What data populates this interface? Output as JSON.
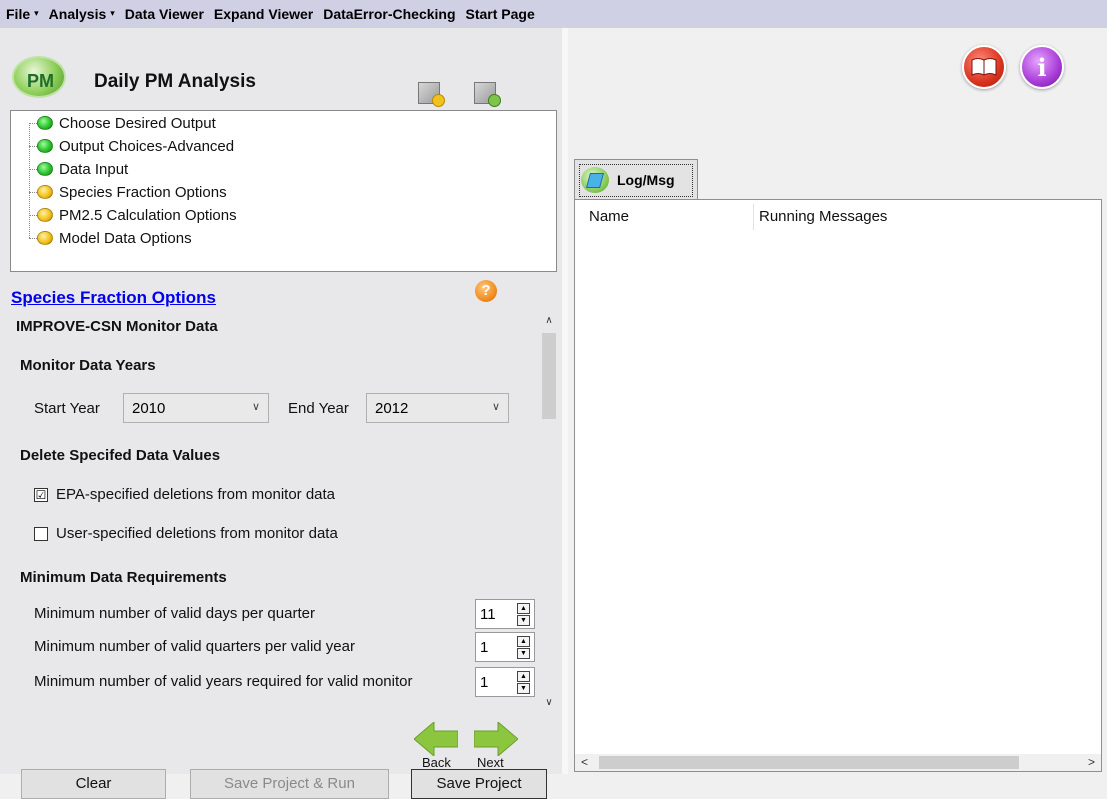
{
  "menu": [
    {
      "label": "File",
      "caret": "▾"
    },
    {
      "label": "Analysis",
      "caret": "▾"
    },
    {
      "label": "Data Viewer",
      "caret": ""
    },
    {
      "label": "Expand Viewer",
      "caret": ""
    },
    {
      "label": "DataError-Checking",
      "caret": ""
    },
    {
      "label": "Start Page",
      "caret": ""
    }
  ],
  "header": {
    "logo_text": "PM",
    "title": "Daily PM Analysis",
    "icons": [
      "add-document-icon",
      "settings-document-icon"
    ]
  },
  "tree": {
    "items": [
      {
        "label": "Choose Desired Output",
        "status": "green"
      },
      {
        "label": "Output Choices-Advanced",
        "status": "green"
      },
      {
        "label": "Data Input",
        "status": "green"
      },
      {
        "label": "Species Fraction Options",
        "status": "yellow"
      },
      {
        "label": "PM2.5 Calculation Options",
        "status": "yellow"
      },
      {
        "label": "Model Data Options",
        "status": "yellow"
      }
    ]
  },
  "section": {
    "title": "Species Fraction Options",
    "help_glyph": "?"
  },
  "panel": {
    "heading": "IMPROVE-CSN Monitor Data",
    "years_heading": "Monitor Data Years",
    "start_year_label": "Start Year",
    "start_year_value": "2010",
    "end_year_label": "End Year",
    "end_year_value": "2012",
    "delete_heading": "Delete Specifed Data Values",
    "epa_deletions_label": "EPA-specified deletions from monitor data",
    "epa_deletions_checked": true,
    "user_deletions_label": "User-specified deletions from monitor data",
    "user_deletions_checked": false,
    "min_heading": "Minimum Data Requirements",
    "min_rows": [
      {
        "label": "Minimum number of valid days per quarter",
        "value": "11"
      },
      {
        "label": "Minimum number of valid quarters per valid year",
        "value": "1"
      },
      {
        "label": "Minimum number of valid years required for valid monitor",
        "value": "1"
      }
    ],
    "check_glyph": "☑"
  },
  "nav": {
    "back_label": "Back",
    "next_label": "Next"
  },
  "buttons": {
    "clear": "Clear",
    "save_run": "Save Project & Run",
    "save": "Save Project"
  },
  "right": {
    "tab_label": "Log/Msg",
    "columns": [
      "Name",
      "Running Messages"
    ],
    "help_book_icon": "book-icon",
    "info_icon": "info-icon",
    "info_glyph": "i"
  },
  "colors": {
    "menubar": "#cfd0e4",
    "link": "#0000ee",
    "green_status": "#2ec22e",
    "yellow_status": "#f2c11b",
    "arrow_green": "#8cc63f"
  }
}
